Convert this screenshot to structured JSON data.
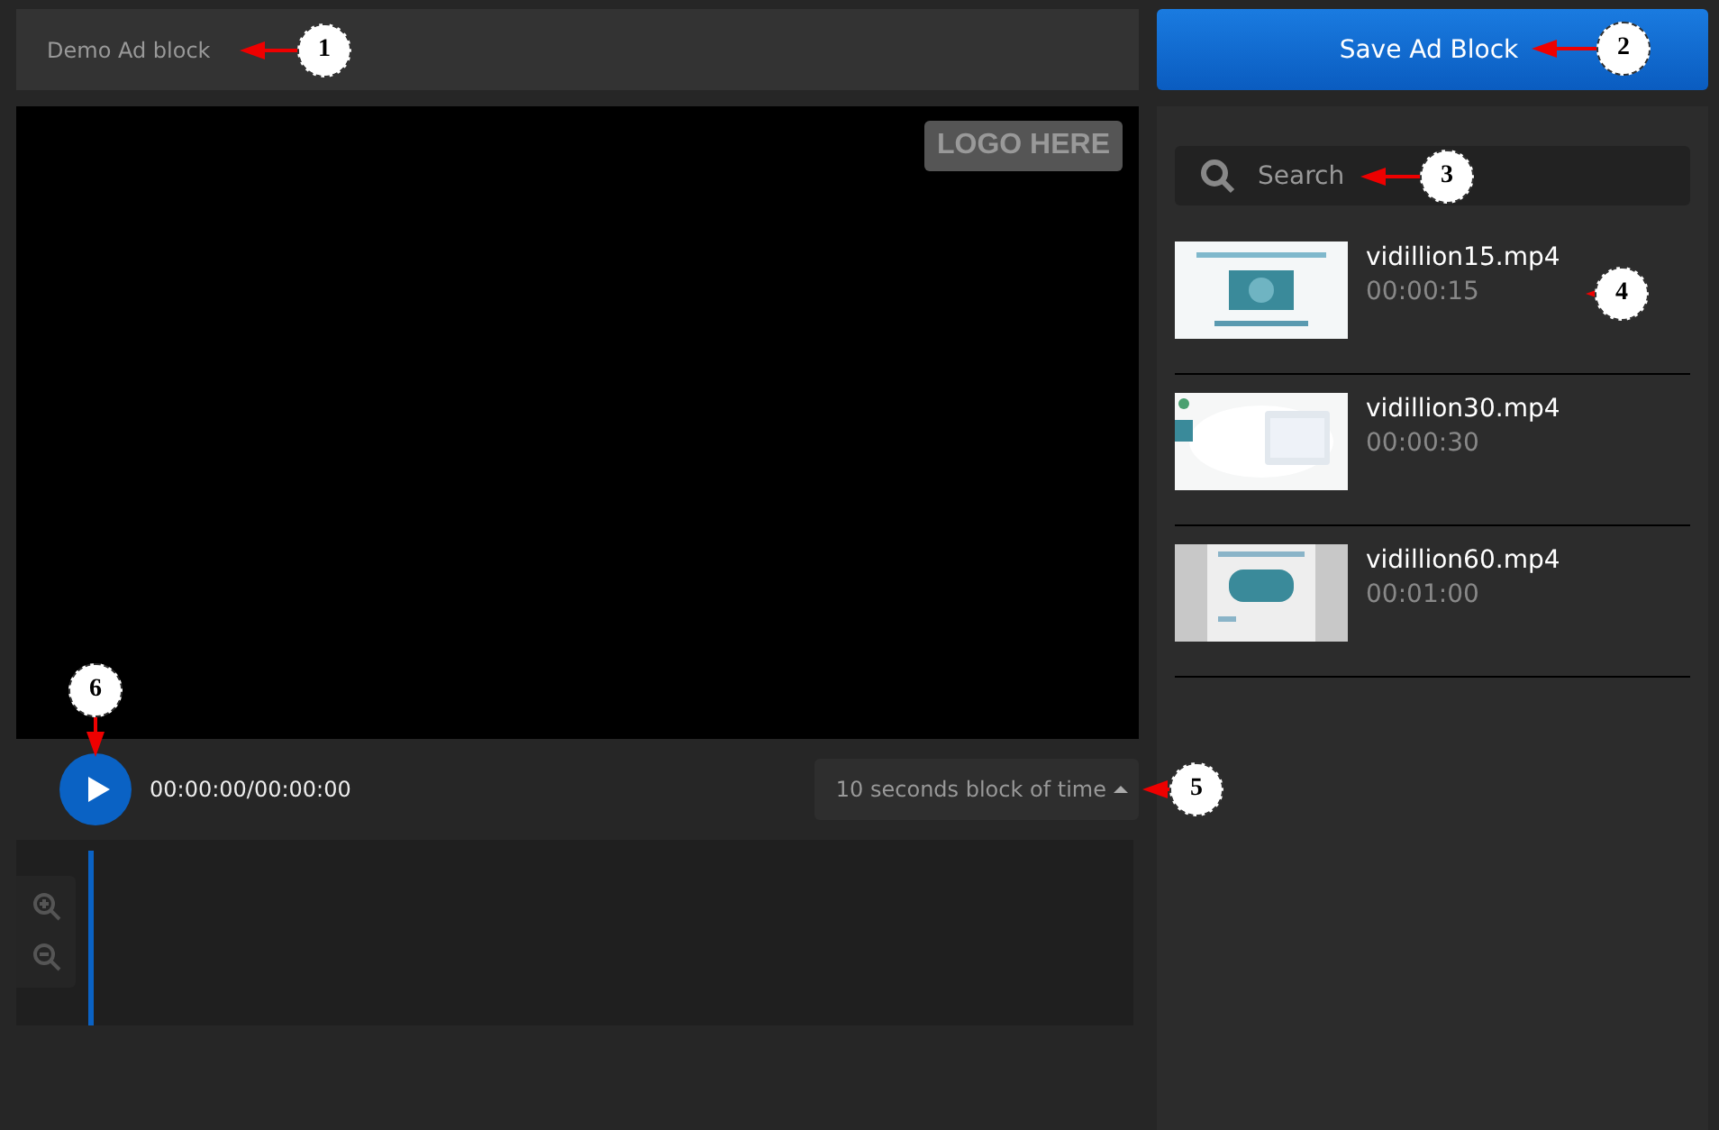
{
  "title": "Demo Ad block",
  "save_button": "Save Ad Block",
  "player": {
    "logo": "LOGO HERE",
    "time": "00:00:00/00:00:00",
    "block_dropdown": "10 seconds block of time"
  },
  "search": {
    "placeholder": "Search"
  },
  "videos": [
    {
      "name": "vidillion15.mp4",
      "duration": "00:00:15"
    },
    {
      "name": "vidillion30.mp4",
      "duration": "00:00:30"
    },
    {
      "name": "vidillion60.mp4",
      "duration": "00:01:00"
    }
  ],
  "callouts": [
    "1",
    "2",
    "3",
    "4",
    "5",
    "6"
  ]
}
